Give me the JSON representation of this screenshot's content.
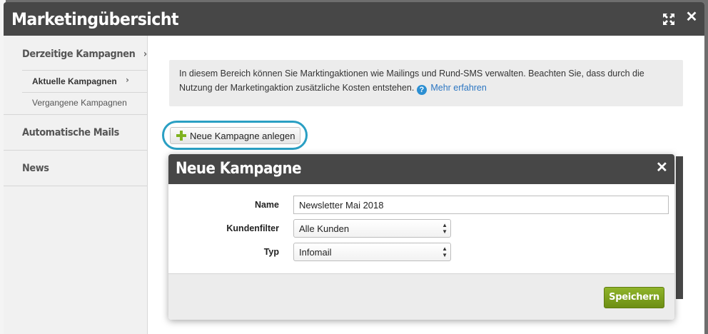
{
  "window": {
    "title": "Marketingübersicht"
  },
  "sidebar": {
    "items": [
      {
        "label": "Derzeitige Kampagnen",
        "chevron": "›"
      },
      {
        "label": "Automatische Mails"
      },
      {
        "label": "News"
      }
    ],
    "subitems": [
      {
        "label": "Aktuelle Kampagnen",
        "chevron": "›"
      },
      {
        "label": "Vergangene Kampagnen"
      }
    ]
  },
  "main": {
    "info_text": "In diesem Bereich können Sie Marktingaktionen wie Mailings und Rund-SMS verwalten. Beachten Sie, dass durch die Nutzung der Marketingaktion zusätzliche Kosten entstehen.",
    "info_link": "Mehr erfahren",
    "new_campaign_button": "Neue Kampagne anlegen"
  },
  "dialog": {
    "title": "Neue Kampagne",
    "fields": {
      "name": {
        "label": "Name",
        "value": "Newsletter Mai 2018"
      },
      "filter": {
        "label": "Kundenfilter",
        "value": "Alle Kunden"
      },
      "type": {
        "label": "Typ",
        "value": "Infomail"
      }
    },
    "save_label": "Speichern"
  },
  "colors": {
    "titlebar": "#474747",
    "accent": "#2a9fc3",
    "save_button": "#7a9c1c",
    "link": "#2c76c2"
  },
  "icons": [
    "expand-icon",
    "close-icon",
    "chevron-right-icon",
    "help-icon",
    "plus-icon"
  ]
}
